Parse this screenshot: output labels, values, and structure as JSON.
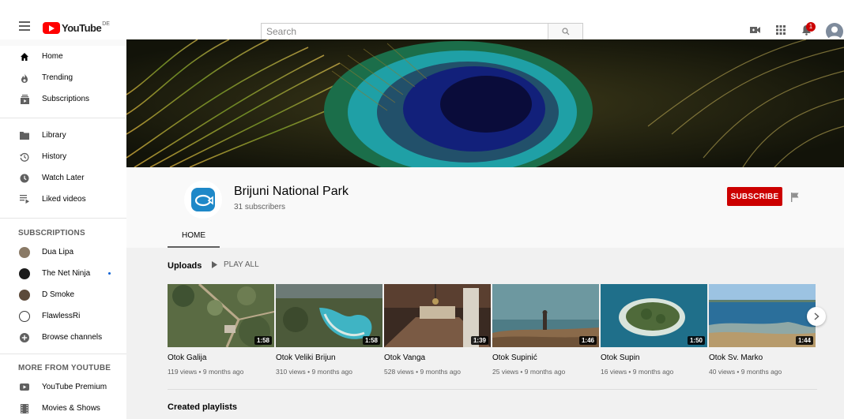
{
  "topbar": {
    "logo_text": "YouTube",
    "logo_region": "DE",
    "search_placeholder": "Search",
    "notification_count": "1"
  },
  "sidebar": {
    "main_items": [
      {
        "label": "Home",
        "icon": "home-icon"
      },
      {
        "label": "Trending",
        "icon": "fire-icon"
      },
      {
        "label": "Subscriptions",
        "icon": "subscriptions-icon"
      }
    ],
    "library_items": [
      {
        "label": "Library",
        "icon": "folder-icon"
      },
      {
        "label": "History",
        "icon": "history-icon"
      },
      {
        "label": "Watch Later",
        "icon": "clock-icon"
      },
      {
        "label": "Liked videos",
        "icon": "playlist-icon"
      }
    ],
    "subscriptions_heading": "SUBSCRIPTIONS",
    "subscriptions": [
      {
        "label": "Dua Lipa",
        "color": "#8a7a66"
      },
      {
        "label": "The Net Ninja",
        "color": "#1c1c1c",
        "live": true
      },
      {
        "label": "D Smoke",
        "color": "#5c4a3a"
      },
      {
        "label": "FlawlessRi",
        "color": "#3c3c3c"
      }
    ],
    "browse_channels": "Browse channels",
    "more_heading": "MORE FROM YOUTUBE",
    "more_items": [
      {
        "label": "YouTube Premium",
        "icon": "youtube-premium-icon"
      },
      {
        "label": "Movies & Shows",
        "icon": "film-icon"
      }
    ]
  },
  "channel": {
    "name": "Brijuni National Park",
    "subscribers": "31 subscribers",
    "subscribe_label": "SUBSCRIBE",
    "tabs": [
      "HOME"
    ]
  },
  "uploads": {
    "title": "Uploads",
    "play_all": "PLAY ALL",
    "videos": [
      {
        "title": "Otok Galija",
        "meta": "119 views • 9 months ago",
        "duration": "1:58"
      },
      {
        "title": "Otok Veliki Brijun",
        "meta": "310 views • 9 months ago",
        "duration": "1:58"
      },
      {
        "title": "Otok Vanga",
        "meta": "528 views • 9 months ago",
        "duration": "1:39"
      },
      {
        "title": "Otok Supinić",
        "meta": "25 views • 9 months ago",
        "duration": "1:46"
      },
      {
        "title": "Otok Supin",
        "meta": "16 views • 9 months ago",
        "duration": "1:50"
      },
      {
        "title": "Otok Sv. Marko",
        "meta": "40 views • 9 months ago",
        "duration": "1:44"
      }
    ]
  },
  "playlists": {
    "title": "Created playlists"
  },
  "colors": {
    "brand_red": "#ff0000",
    "subscribe_red": "#cc0000",
    "channel_blue": "#1e88c8"
  }
}
